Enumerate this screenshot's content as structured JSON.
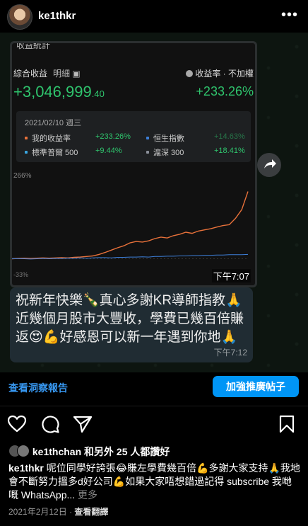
{
  "header": {
    "username": "ke1thkr",
    "more_icon": "more-icon"
  },
  "screenshot": {
    "title": "收益統計",
    "combined_label": "綜合收益",
    "detail_label": "明細",
    "rate_label": "收益率 · 不加權",
    "big_value_main": "+3,046,999",
    "big_value_cents": ".40",
    "big_pct": "+233.26%",
    "date": "2021/02/10 週三",
    "legend": [
      {
        "name": "我的收益率",
        "value": "+233.26%",
        "color": "#e8713a"
      },
      {
        "name": "恒生指數",
        "value": "+14.63%",
        "color": "#3d7fd9"
      },
      {
        "name": "標準普爾 500",
        "value": "+9.44%",
        "color": "#3aa6e0"
      },
      {
        "name": "滬深 300",
        "value": "+18.41%",
        "color": "#8a8f99"
      }
    ],
    "y_max_label": "266%",
    "y_min_label": "-33%",
    "time": "下午7:07"
  },
  "chart_data": {
    "type": "line",
    "ylim": [
      -33,
      266
    ],
    "series": [
      {
        "name": "我的收益率",
        "values": [
          0,
          1,
          2,
          1,
          2,
          3,
          2,
          3,
          4,
          3,
          5,
          6,
          8,
          10,
          15,
          22,
          30,
          38,
          45,
          55,
          60,
          58,
          62,
          70,
          75,
          72,
          80,
          85,
          92,
          88,
          96,
          100,
          104,
          110,
          115,
          118,
          140,
          170,
          233
        ]
      },
      {
        "name": "恒生指數",
        "values": [
          0,
          0,
          0,
          -1,
          0,
          1,
          0,
          1,
          1,
          2,
          2,
          3,
          2,
          3,
          4,
          4,
          3,
          5,
          5,
          6,
          6,
          7,
          6,
          8,
          8,
          9,
          9,
          10,
          10,
          11,
          11,
          12,
          12,
          13,
          13,
          14,
          14,
          14,
          15
        ]
      }
    ]
  },
  "message": {
    "text": "祝新年快樂🍾真心多謝KR導師指教🙏近幾個月股市大豐收，學費已幾百倍賺返😍💪好感恩可以新一年遇到你地🙏",
    "time": "下午7:12"
  },
  "insights": {
    "view_insights": "查看洞察報告",
    "boost": "加強推廣帖子"
  },
  "likes": {
    "text": "ke1thchan 和另外 25 人都讚好"
  },
  "caption": {
    "username": "ke1thkr",
    "text": " 呢位同學好誇張😂賺左學費幾百倍💪多謝大家支持🙏我地會不斷努力搵多d好公司💪如果大家唔想錯過記得 subscribe 我哋嘅 WhatsApp...",
    "more": "更多"
  },
  "meta": {
    "date": "2021年2月12日",
    "separator": "·",
    "translate": "查看翻譯"
  }
}
